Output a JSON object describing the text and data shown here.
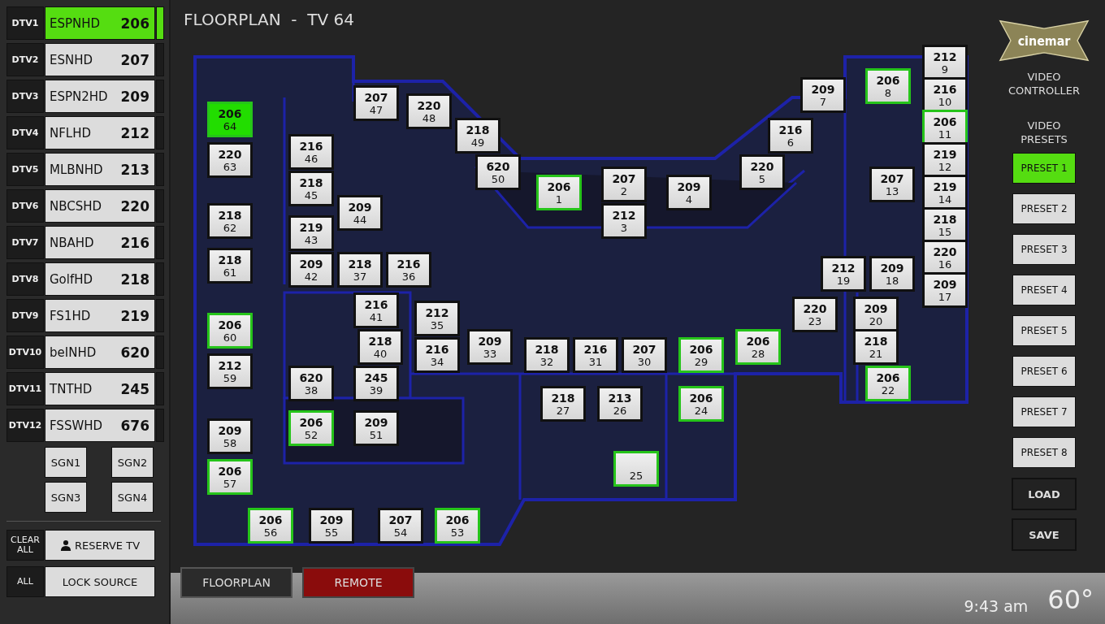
{
  "header": {
    "title": "FLOORPLAN  -  TV 64"
  },
  "sources": [
    {
      "tag": "DTV1",
      "name": "ESPNHD",
      "channel": "206",
      "selected": true
    },
    {
      "tag": "DTV2",
      "name": "ESNHD",
      "channel": "207",
      "selected": false
    },
    {
      "tag": "DTV3",
      "name": "ESPN2HD",
      "channel": "209",
      "selected": false
    },
    {
      "tag": "DTV4",
      "name": "NFLHD",
      "channel": "212",
      "selected": false
    },
    {
      "tag": "DTV5",
      "name": "MLBNHD",
      "channel": "213",
      "selected": false
    },
    {
      "tag": "DTV6",
      "name": "NBCSHD",
      "channel": "220",
      "selected": false
    },
    {
      "tag": "DTV7",
      "name": "NBAHD",
      "channel": "216",
      "selected": false
    },
    {
      "tag": "DTV8",
      "name": "GolfHD",
      "channel": "218",
      "selected": false
    },
    {
      "tag": "DTV9",
      "name": "FS1HD",
      "channel": "219",
      "selected": false
    },
    {
      "tag": "DTV10",
      "name": "beINHD",
      "channel": "620",
      "selected": false
    },
    {
      "tag": "DTV11",
      "name": "TNTHD",
      "channel": "245",
      "selected": false
    },
    {
      "tag": "DTV12",
      "name": "FSSWHD",
      "channel": "676",
      "selected": false
    }
  ],
  "signage": [
    "SGN1",
    "SGN2",
    "SGN3",
    "SGN4"
  ],
  "actions": [
    {
      "tag": "CLEAR ALL",
      "label": "RESERVE TV",
      "kind": "reserve"
    },
    {
      "tag": "ALL",
      "label": "LOCK SOURCE",
      "kind": "lock"
    }
  ],
  "floorplan": {
    "tvs": [
      {
        "channel": "212",
        "number": "9",
        "highlighted": false,
        "selected": false
      },
      {
        "channel": "206",
        "number": "8",
        "highlighted": true,
        "selected": false
      },
      {
        "channel": "207",
        "number": "47",
        "highlighted": false,
        "selected": false
      },
      {
        "channel": "209",
        "number": "7",
        "highlighted": false,
        "selected": false
      },
      {
        "channel": "216",
        "number": "10",
        "highlighted": false,
        "selected": false
      },
      {
        "channel": "206",
        "number": "64",
        "highlighted": true,
        "selected": true
      },
      {
        "channel": "220",
        "number": "48",
        "highlighted": false,
        "selected": false
      },
      {
        "channel": "218",
        "number": "49",
        "highlighted": false,
        "selected": false
      },
      {
        "channel": "216",
        "number": "6",
        "highlighted": false,
        "selected": false
      },
      {
        "channel": "206",
        "number": "11",
        "highlighted": true,
        "selected": false
      },
      {
        "channel": "220",
        "number": "63",
        "highlighted": false,
        "selected": false
      },
      {
        "channel": "216",
        "number": "46",
        "highlighted": false,
        "selected": false
      },
      {
        "channel": "219",
        "number": "12",
        "highlighted": false,
        "selected": false
      },
      {
        "channel": "620",
        "number": "50",
        "highlighted": false,
        "selected": false
      },
      {
        "channel": "220",
        "number": "5",
        "highlighted": false,
        "selected": false
      },
      {
        "channel": "218",
        "number": "45",
        "highlighted": false,
        "selected": false
      },
      {
        "channel": "206",
        "number": "1",
        "highlighted": true,
        "selected": false
      },
      {
        "channel": "207",
        "number": "2",
        "highlighted": false,
        "selected": false
      },
      {
        "channel": "209",
        "number": "4",
        "highlighted": false,
        "selected": false
      },
      {
        "channel": "207",
        "number": "13",
        "highlighted": false,
        "selected": false
      },
      {
        "channel": "219",
        "number": "14",
        "highlighted": false,
        "selected": false
      },
      {
        "channel": "218",
        "number": "62",
        "highlighted": false,
        "selected": false
      },
      {
        "channel": "209",
        "number": "44",
        "highlighted": false,
        "selected": false
      },
      {
        "channel": "212",
        "number": "3",
        "highlighted": false,
        "selected": false
      },
      {
        "channel": "218",
        "number": "15",
        "highlighted": false,
        "selected": false
      },
      {
        "channel": "219",
        "number": "43",
        "highlighted": false,
        "selected": false
      },
      {
        "channel": "218",
        "number": "61",
        "highlighted": false,
        "selected": false
      },
      {
        "channel": "209",
        "number": "42",
        "highlighted": false,
        "selected": false
      },
      {
        "channel": "218",
        "number": "37",
        "highlighted": false,
        "selected": false
      },
      {
        "channel": "216",
        "number": "36",
        "highlighted": false,
        "selected": false
      },
      {
        "channel": "212",
        "number": "19",
        "highlighted": false,
        "selected": false
      },
      {
        "channel": "209",
        "number": "18",
        "highlighted": false,
        "selected": false
      },
      {
        "channel": "220",
        "number": "16",
        "highlighted": false,
        "selected": false
      },
      {
        "channel": "209",
        "number": "17",
        "highlighted": false,
        "selected": false
      },
      {
        "channel": "216",
        "number": "41",
        "highlighted": false,
        "selected": false
      },
      {
        "channel": "212",
        "number": "35",
        "highlighted": false,
        "selected": false
      },
      {
        "channel": "220",
        "number": "23",
        "highlighted": false,
        "selected": false
      },
      {
        "channel": "209",
        "number": "20",
        "highlighted": false,
        "selected": false
      },
      {
        "channel": "206",
        "number": "60",
        "highlighted": true,
        "selected": false
      },
      {
        "channel": "218",
        "number": "40",
        "highlighted": false,
        "selected": false
      },
      {
        "channel": "216",
        "number": "34",
        "highlighted": false,
        "selected": false
      },
      {
        "channel": "209",
        "number": "33",
        "highlighted": false,
        "selected": false
      },
      {
        "channel": "218",
        "number": "32",
        "highlighted": false,
        "selected": false
      },
      {
        "channel": "216",
        "number": "31",
        "highlighted": false,
        "selected": false
      },
      {
        "channel": "207",
        "number": "30",
        "highlighted": false,
        "selected": false
      },
      {
        "channel": "206",
        "number": "29",
        "highlighted": true,
        "selected": false
      },
      {
        "channel": "206",
        "number": "28",
        "highlighted": true,
        "selected": false
      },
      {
        "channel": "218",
        "number": "21",
        "highlighted": false,
        "selected": false
      },
      {
        "channel": "212",
        "number": "59",
        "highlighted": false,
        "selected": false
      },
      {
        "channel": "620",
        "number": "38",
        "highlighted": false,
        "selected": false
      },
      {
        "channel": "245",
        "number": "39",
        "highlighted": false,
        "selected": false
      },
      {
        "channel": "206",
        "number": "22",
        "highlighted": true,
        "selected": false
      },
      {
        "channel": "218",
        "number": "27",
        "highlighted": false,
        "selected": false
      },
      {
        "channel": "213",
        "number": "26",
        "highlighted": false,
        "selected": false
      },
      {
        "channel": "206",
        "number": "24",
        "highlighted": true,
        "selected": false
      },
      {
        "channel": "209",
        "number": "58",
        "highlighted": false,
        "selected": false
      },
      {
        "channel": "206",
        "number": "52",
        "highlighted": true,
        "selected": false
      },
      {
        "channel": "209",
        "number": "51",
        "highlighted": false,
        "selected": false
      },
      {
        "channel": "206",
        "number": "57",
        "highlighted": true,
        "selected": false
      },
      {
        "number": "25",
        "highlighted": true,
        "selected": false
      },
      {
        "channel": "206",
        "number": "56",
        "highlighted": true,
        "selected": false
      },
      {
        "channel": "209",
        "number": "55",
        "highlighted": false,
        "selected": false
      },
      {
        "channel": "207",
        "number": "54",
        "highlighted": false,
        "selected": false
      },
      {
        "channel": "206",
        "number": "53",
        "highlighted": true,
        "selected": false
      }
    ]
  },
  "logo": {
    "text": "cinemar"
  },
  "controller_label": "VIDEO CONTROLLER",
  "presets": {
    "title": "VIDEO PRESETS",
    "items": [
      {
        "label": "PRESET 1",
        "selected": true
      },
      {
        "label": "PRESET 2",
        "selected": false
      },
      {
        "label": "PRESET 3",
        "selected": false
      },
      {
        "label": "PRESET 4",
        "selected": false
      },
      {
        "label": "PRESET 5",
        "selected": false
      },
      {
        "label": "PRESET 6",
        "selected": false
      },
      {
        "label": "PRESET 7",
        "selected": false
      },
      {
        "label": "PRESET 8",
        "selected": false
      }
    ]
  },
  "preset_actions": [
    "LOAD",
    "SAVE"
  ],
  "tabs": [
    {
      "label": "FLOORPLAN",
      "selected": true
    },
    {
      "label": "REMOTE",
      "selected": false
    }
  ],
  "status": {
    "time": "9:43 am",
    "temperature": "60°"
  }
}
